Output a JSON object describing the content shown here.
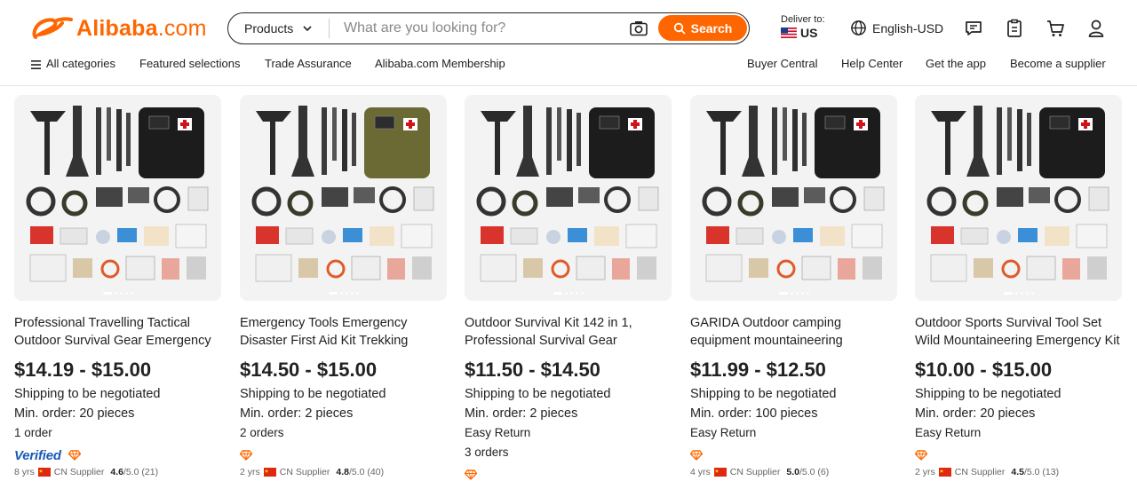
{
  "header": {
    "logo_text": "Alibaba",
    "logo_suffix": ".com",
    "search": {
      "category": "Products",
      "placeholder": "What are you looking for?",
      "button_label": "Search"
    },
    "deliver_label": "Deliver to:",
    "deliver_country": "US",
    "language": "English-USD",
    "icons": [
      "message-icon",
      "orders-icon",
      "cart-icon",
      "account-icon"
    ],
    "accent": "#ff6600"
  },
  "nav": {
    "all_categories": "All categories",
    "featured": "Featured selections",
    "trade_assurance": "Trade Assurance",
    "membership": "Alibaba.com Membership",
    "buyer_central": "Buyer Central",
    "help_center": "Help Center",
    "get_app": "Get the app",
    "become_supplier": "Become a supplier"
  },
  "products": [
    {
      "title_line1": "Professional Travelling Tactical",
      "title_line2": "Outdoor Survival Gear Emergency",
      "price": "$14.19 - $15.00",
      "shipping": "Shipping to be negotiated",
      "min_order": "Min. order: 20 pieces",
      "extra1": "1 order",
      "extra2": "",
      "verified": "Verified",
      "years": "8 yrs",
      "supplier": "CN Supplier",
      "rating": "4.6",
      "rating_suffix": "/5.0 (21)",
      "bag_color": "#1c1c1c"
    },
    {
      "title_line1": "Emergency Tools Emergency",
      "title_line2": "Disaster First Aid Kit Trekking",
      "price": "$14.50 - $15.00",
      "shipping": "Shipping to be negotiated",
      "min_order": "Min. order: 2 pieces",
      "extra1": "2 orders",
      "extra2": "",
      "verified": "",
      "years": "2 yrs",
      "supplier": "CN Supplier",
      "rating": "4.8",
      "rating_suffix": "/5.0 (40)",
      "bag_color": "#6b6a35"
    },
    {
      "title_line1": "Outdoor Survival Kit 142 in 1,",
      "title_line2": "Professional Survival Gear",
      "price": "$11.50 - $14.50",
      "shipping": "Shipping to be negotiated",
      "min_order": "Min. order: 2 pieces",
      "extra1": "Easy Return",
      "extra2": "3 orders",
      "verified": "",
      "years": "",
      "supplier": "",
      "rating": "",
      "rating_suffix": "",
      "bag_color": "#1c1c1c"
    },
    {
      "title_line1": "GARIDA Outdoor camping",
      "title_line2": "equipment mountaineering",
      "price": "$11.99 - $12.50",
      "shipping": "Shipping to be negotiated",
      "min_order": "Min. order: 100 pieces",
      "extra1": "Easy Return",
      "extra2": "",
      "verified": "",
      "years": "4 yrs",
      "supplier": "CN Supplier",
      "rating": "5.0",
      "rating_suffix": "/5.0 (6)",
      "bag_color": "#1c1c1c"
    },
    {
      "title_line1": "Outdoor Sports Survival Tool Set",
      "title_line2": "Wild Mountaineering Emergency Kit",
      "price": "$10.00 - $15.00",
      "shipping": "Shipping to be negotiated",
      "min_order": "Min. order: 20 pieces",
      "extra1": "Easy Return",
      "extra2": "",
      "verified": "",
      "years": "2 yrs",
      "supplier": "CN Supplier",
      "rating": "4.5",
      "rating_suffix": "/5.0 (13)",
      "bag_color": "#1c1c1c"
    }
  ]
}
